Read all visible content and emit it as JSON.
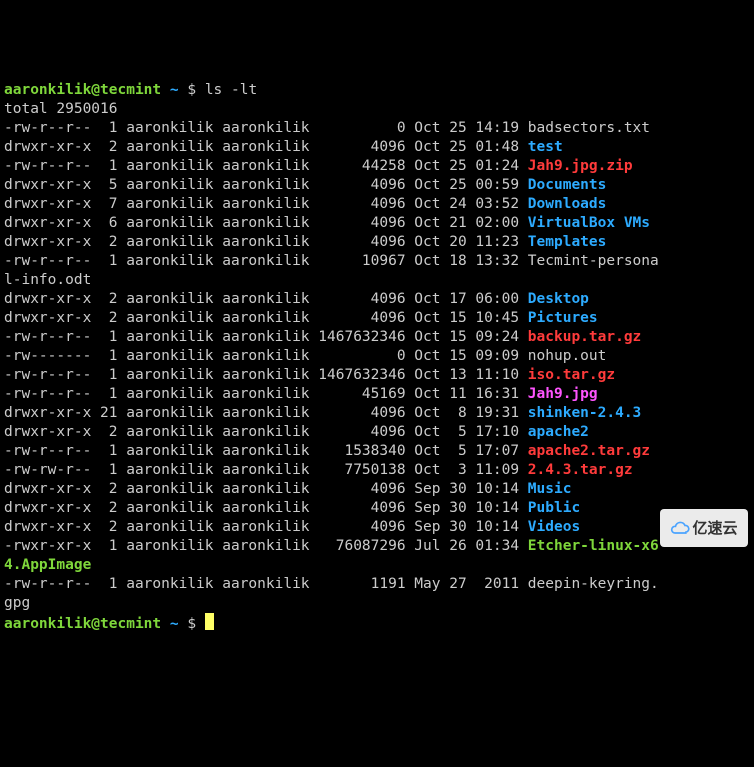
{
  "prompt": {
    "user_host": "aaronkilik@tecmint",
    "path": "~",
    "symbol": "$"
  },
  "command": "ls -lt",
  "total_label": "total",
  "total_value": "2950016",
  "files": [
    {
      "perm": "-rw-r--r--",
      "links": "1",
      "owner": "aaronkilik",
      "group": "aaronkilik",
      "size": "0",
      "date": "Oct 25 14:19",
      "name": "badsectors.txt",
      "cls": "w"
    },
    {
      "perm": "drwxr-xr-x",
      "links": "2",
      "owner": "aaronkilik",
      "group": "aaronkilik",
      "size": "4096",
      "date": "Oct 25 01:48",
      "name": "test",
      "cls": "b"
    },
    {
      "perm": "-rw-r--r--",
      "links": "1",
      "owner": "aaronkilik",
      "group": "aaronkilik",
      "size": "44258",
      "date": "Oct 25 01:24",
      "name": "Jah9.jpg.zip",
      "cls": "r"
    },
    {
      "perm": "drwxr-xr-x",
      "links": "5",
      "owner": "aaronkilik",
      "group": "aaronkilik",
      "size": "4096",
      "date": "Oct 25 00:59",
      "name": "Documents",
      "cls": "b"
    },
    {
      "perm": "drwxr-xr-x",
      "links": "7",
      "owner": "aaronkilik",
      "group": "aaronkilik",
      "size": "4096",
      "date": "Oct 24 03:52",
      "name": "Downloads",
      "cls": "b"
    },
    {
      "perm": "drwxr-xr-x",
      "links": "6",
      "owner": "aaronkilik",
      "group": "aaronkilik",
      "size": "4096",
      "date": "Oct 21 02:00",
      "name": "VirtualBox VMs",
      "cls": "b"
    },
    {
      "perm": "drwxr-xr-x",
      "links": "2",
      "owner": "aaronkilik",
      "group": "aaronkilik",
      "size": "4096",
      "date": "Oct 20 11:23",
      "name": "Templates",
      "cls": "b"
    },
    {
      "perm": "-rw-r--r--",
      "links": "1",
      "owner": "aaronkilik",
      "group": "aaronkilik",
      "size": "10967",
      "date": "Oct 18 13:32",
      "name": "Tecmint-persona",
      "cls": "w",
      "wrap": "l-info.odt"
    },
    {
      "perm": "drwxr-xr-x",
      "links": "2",
      "owner": "aaronkilik",
      "group": "aaronkilik",
      "size": "4096",
      "date": "Oct 17 06:00",
      "name": "Desktop",
      "cls": "b"
    },
    {
      "perm": "drwxr-xr-x",
      "links": "2",
      "owner": "aaronkilik",
      "group": "aaronkilik",
      "size": "4096",
      "date": "Oct 15 10:45",
      "name": "Pictures",
      "cls": "b"
    },
    {
      "perm": "-rw-r--r--",
      "links": "1",
      "owner": "aaronkilik",
      "group": "aaronkilik",
      "size": "1467632346",
      "date": "Oct 15 09:24",
      "name": "backup.tar.gz",
      "cls": "r"
    },
    {
      "perm": "-rw-------",
      "links": "1",
      "owner": "aaronkilik",
      "group": "aaronkilik",
      "size": "0",
      "date": "Oct 15 09:09",
      "name": "nohup.out",
      "cls": "w"
    },
    {
      "perm": "-rw-r--r--",
      "links": "1",
      "owner": "aaronkilik",
      "group": "aaronkilik",
      "size": "1467632346",
      "date": "Oct 13 11:10",
      "name": "iso.tar.gz",
      "cls": "r"
    },
    {
      "perm": "-rw-r--r--",
      "links": "1",
      "owner": "aaronkilik",
      "group": "aaronkilik",
      "size": "45169",
      "date": "Oct 11 16:31",
      "name": "Jah9.jpg",
      "cls": "mg"
    },
    {
      "perm": "drwxr-xr-x",
      "links": "21",
      "owner": "aaronkilik",
      "group": "aaronkilik",
      "size": "4096",
      "date": "Oct  8 19:31",
      "name": "shinken-2.4.3",
      "cls": "b"
    },
    {
      "perm": "drwxr-xr-x",
      "links": "2",
      "owner": "aaronkilik",
      "group": "aaronkilik",
      "size": "4096",
      "date": "Oct  5 17:10",
      "name": "apache2",
      "cls": "b"
    },
    {
      "perm": "-rw-r--r--",
      "links": "1",
      "owner": "aaronkilik",
      "group": "aaronkilik",
      "size": "1538340",
      "date": "Oct  5 17:07",
      "name": "apache2.tar.gz",
      "cls": "r"
    },
    {
      "perm": "-rw-rw-r--",
      "links": "1",
      "owner": "aaronkilik",
      "group": "aaronkilik",
      "size": "7750138",
      "date": "Oct  3 11:09",
      "name": "2.4.3.tar.gz",
      "cls": "r"
    },
    {
      "perm": "drwxr-xr-x",
      "links": "2",
      "owner": "aaronkilik",
      "group": "aaronkilik",
      "size": "4096",
      "date": "Sep 30 10:14",
      "name": "Music",
      "cls": "b"
    },
    {
      "perm": "drwxr-xr-x",
      "links": "2",
      "owner": "aaronkilik",
      "group": "aaronkilik",
      "size": "4096",
      "date": "Sep 30 10:14",
      "name": "Public",
      "cls": "b"
    },
    {
      "perm": "drwxr-xr-x",
      "links": "2",
      "owner": "aaronkilik",
      "group": "aaronkilik",
      "size": "4096",
      "date": "Sep 30 10:14",
      "name": "Videos",
      "cls": "b"
    },
    {
      "perm": "-rwxr-xr-x",
      "links": "1",
      "owner": "aaronkilik",
      "group": "aaronkilik",
      "size": "76087296",
      "date": "Jul 26 01:34",
      "name": "Etcher-linux-x6",
      "cls": "g",
      "wrap": "4.AppImage"
    },
    {
      "perm": "-rw-r--r--",
      "links": "1",
      "owner": "aaronkilik",
      "group": "aaronkilik",
      "size": "1191",
      "date": "May 27  2011",
      "name": "deepin-keyring.",
      "cls": "w",
      "wrap": "gpg"
    }
  ],
  "watermark": "亿速云"
}
